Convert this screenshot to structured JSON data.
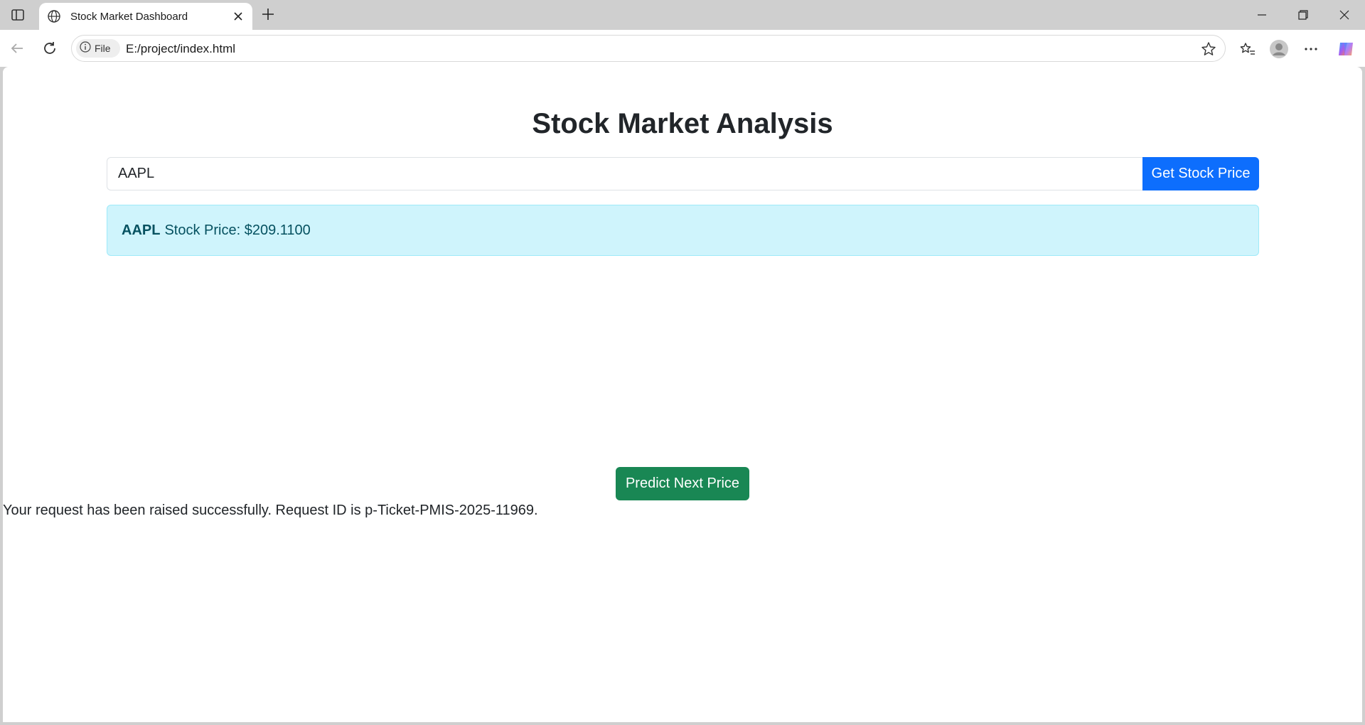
{
  "browser": {
    "tab_title": "Stock Market Dashboard",
    "site_chip_label": "File",
    "url": "E:/project/index.html"
  },
  "page": {
    "title": "Stock Market Analysis",
    "symbol_input_value": "AAPL",
    "get_price_label": "Get Stock Price",
    "result": {
      "symbol": "AAPL",
      "text": "Stock Price: $209.1100"
    },
    "predict_label": "Predict Next Price",
    "request_message": "Your request has been raised successfully. Request ID is p-Ticket-PMIS-2025-11969."
  },
  "colors": {
    "primary": "#0d6efd",
    "success": "#198754",
    "info_bg": "#cff4fc",
    "info_text": "#055160"
  }
}
